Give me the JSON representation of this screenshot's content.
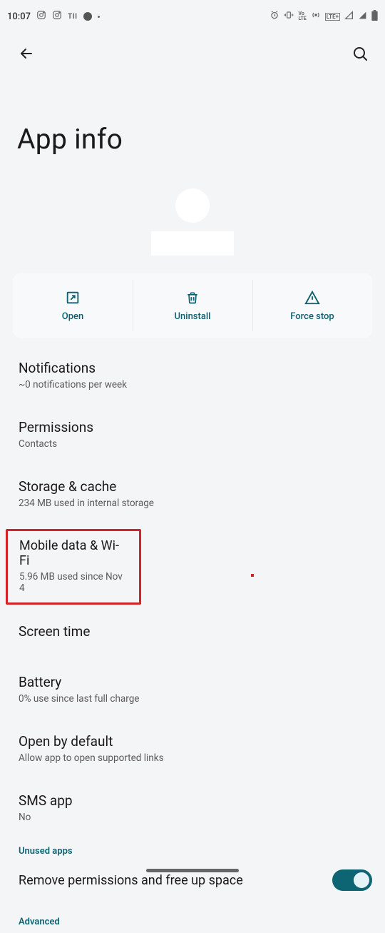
{
  "status_bar": {
    "time": "10:07",
    "left_icons": [
      "instagram-outline",
      "instagram-outline",
      "TII",
      "circle",
      "dot"
    ],
    "right_icons": [
      "alarm",
      "vibrate",
      "volte-lte",
      "hotspot",
      "LTE+",
      "signal-1",
      "signal-2",
      "battery"
    ]
  },
  "header": {
    "title": "App info"
  },
  "actions": {
    "open": "Open",
    "uninstall": "Uninstall",
    "force_stop": "Force stop"
  },
  "items": {
    "notifications": {
      "title": "Notifications",
      "sub": "~0 notifications per week"
    },
    "permissions": {
      "title": "Permissions",
      "sub": "Contacts"
    },
    "storage": {
      "title": "Storage & cache",
      "sub": "234 MB used in internal storage"
    },
    "mobile_data": {
      "title": "Mobile data & Wi-Fi",
      "sub": "5.96 MB used since Nov 4"
    },
    "screen_time": {
      "title": "Screen time"
    },
    "battery": {
      "title": "Battery",
      "sub": "0% use since last full charge"
    },
    "open_default": {
      "title": "Open by default",
      "sub": "Allow app to open supported links"
    },
    "sms_app": {
      "title": "SMS app",
      "sub": "No"
    }
  },
  "sections": {
    "unused_apps": "Unused apps",
    "advanced": "Advanced"
  },
  "toggle": {
    "remove_permissions": "Remove permissions and free up space",
    "state": true
  }
}
